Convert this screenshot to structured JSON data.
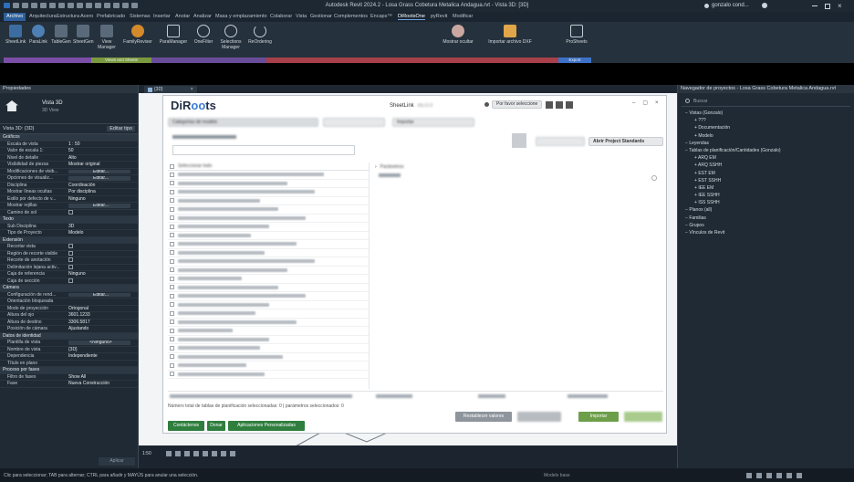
{
  "window": {
    "title": "Autodesk Revit 2024.2 - Losa Grass Cobetura Metalica Andagua.rvt - Vista 3D: [3D]",
    "user": "gonzalo cond...",
    "menu_tabs": [
      "Archivo",
      "Arquitectura",
      "Estructura",
      "Acero",
      "Prefabricado",
      "Sistemas",
      "Insertar",
      "Anotar",
      "Analizar",
      "Masa y emplazamiento",
      "Colaborar",
      "Vista",
      "Gestionar",
      "Complementos",
      "Encaps™",
      "DiRootsOne",
      "pyRevit",
      "Modificar"
    ]
  },
  "ribbon": {
    "buttons": [
      "SheetLink",
      "ParaLink",
      "TableGen",
      "SheetGen",
      "View Manager",
      "FamilyReviser",
      "ParaManager",
      "OneFilter",
      "Selections Manager",
      "ReOrdering",
      "Mostrar ocultar",
      "Importar archivo DXF",
      "ProSheets"
    ],
    "panels": [
      "Views and Sheets",
      "Export"
    ]
  },
  "properties": {
    "header": "Propiedades",
    "type_name": "Vista 3D",
    "type_sub": "3D View",
    "instance": "Vista 3D: {3D}",
    "edit_type": "Editar tipo",
    "rows": [
      {
        "k": "Gráficos",
        "grp": true
      },
      {
        "k": "Escala de vista",
        "v": "1 : 50"
      },
      {
        "k": "Valor de escala  1:",
        "v": "50"
      },
      {
        "k": "Nivel de detalle",
        "v": "Alto"
      },
      {
        "k": "Visibilidad de piezas",
        "v": "Mostrar original"
      },
      {
        "k": "Modificaciones de visib...",
        "v": "Editar...",
        "btn": true
      },
      {
        "k": "Opciones de visualiz...",
        "v": "Editar...",
        "btn": true
      },
      {
        "k": "Disciplina",
        "v": "Coordinación"
      },
      {
        "k": "Mostrar líneas ocultas",
        "v": "Por disciplina"
      },
      {
        "k": "Estilo por defecto de v...",
        "v": "Ninguno"
      },
      {
        "k": "Mostrar rejillas",
        "v": "Editar...",
        "btn": true
      },
      {
        "k": "Camino de sol",
        "v": "",
        "cb": true
      },
      {
        "k": "Texto",
        "grp": true
      },
      {
        "k": "Sub Disciplina",
        "v": "3D"
      },
      {
        "k": "Tipo de Proyecto",
        "v": "Modelo"
      },
      {
        "k": "Extensión",
        "grp": true
      },
      {
        "k": "Recortar vista",
        "v": "",
        "cb": true
      },
      {
        "k": "Región de recorte visible",
        "v": "",
        "cb": true
      },
      {
        "k": "Recorte de anotación",
        "v": "",
        "cb": true
      },
      {
        "k": "Delimitación lejana activ...",
        "v": "",
        "cb": true
      },
      {
        "k": "Caja de referencia",
        "v": "Ninguno"
      },
      {
        "k": "Caja de sección",
        "v": "",
        "cb": true
      },
      {
        "k": "Cámara",
        "grp": true
      },
      {
        "k": "Configuración de rend...",
        "v": "Editar...",
        "btn": true
      },
      {
        "k": "Orientación bloqueada",
        "v": ""
      },
      {
        "k": "Modo de proyección",
        "v": "Ortogonal"
      },
      {
        "k": "Altura del ojo",
        "v": "3601.1233"
      },
      {
        "k": "Altura de destino",
        "v": "3306.5817"
      },
      {
        "k": "Posición de cámara",
        "v": "Ajustando"
      },
      {
        "k": "Datos de identidad",
        "grp": true
      },
      {
        "k": "Plantilla de vista",
        "v": "<Ninguno>",
        "btn": true
      },
      {
        "k": "Nombre de vista",
        "v": "{3D}"
      },
      {
        "k": "Dependencia",
        "v": "Independiente"
      },
      {
        "k": "Título en plano",
        "v": ""
      },
      {
        "k": "Proceso por fases",
        "grp": true
      },
      {
        "k": "Filtro de fases",
        "v": "Show All"
      },
      {
        "k": "Fase",
        "v": "Nueva Construcción"
      }
    ],
    "apply": "Aplicar"
  },
  "view_tab": "{3D}",
  "dialog": {
    "logo_a": "DiR",
    "logo_dot": "oo",
    "logo_b": "ts",
    "app": "SheetLink",
    "version": "v5.0.0",
    "language": "Por favor seleccione",
    "category_label": "Categorías de modelo",
    "import_label": "Importar",
    "open_standards": "Abrir Project Standards",
    "left_header": "Seleccionar todo",
    "right_header": "Parámetros",
    "footer_text": "Número total de tablas de planificación seleccionadas: 0 | parámetros seleccionados: 0",
    "btn_contact": "Contáctenos",
    "btn_donate": "Donar",
    "btn_custom": "Aplicaciones Personalizadas",
    "btn_restore": "Restablecer valores",
    "btn_import": "Importar"
  },
  "browser": {
    "header": "Navegador de proyectos - Losa Grass Cobetura Metalica Andagua.rvt",
    "search": "Buscar",
    "items": [
      {
        "t": "Vistas (Gonzalo)",
        "lvl": 0
      },
      {
        "t": "???",
        "lvl": 1
      },
      {
        "t": "Documentación",
        "lvl": 1
      },
      {
        "t": "Modelo",
        "lvl": 1
      },
      {
        "t": "Leyendas",
        "lvl": 0
      },
      {
        "t": "Tablas de planificación/Cantidades (Gonzalo)",
        "lvl": 0
      },
      {
        "t": "ARQ EM",
        "lvl": 1
      },
      {
        "t": "ARQ SSHH",
        "lvl": 1
      },
      {
        "t": "EST EM",
        "lvl": 1
      },
      {
        "t": "EST SSHH",
        "lvl": 1
      },
      {
        "t": "IEE EM",
        "lvl": 1
      },
      {
        "t": "IEE SSHH",
        "lvl": 1
      },
      {
        "t": "ISS SSHH",
        "lvl": 1
      },
      {
        "t": "Planos (all)",
        "lvl": 0
      },
      {
        "t": "Familias",
        "lvl": 0
      },
      {
        "t": "Grupos",
        "lvl": 0
      },
      {
        "t": "Vínculos de Revit",
        "lvl": 0
      }
    ]
  },
  "viewctrl": {
    "scale": "1:50"
  },
  "status": {
    "message": "Clic para seleccionar; TAB para alternar; CTRL para añadir y MAYÚS para anular una selección.",
    "model": "Modelo base"
  }
}
